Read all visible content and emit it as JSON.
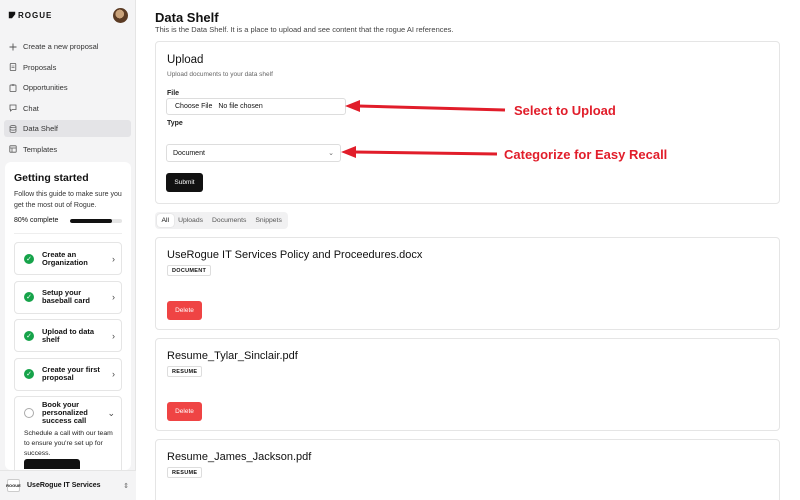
{
  "app": {
    "logo_text": "ROGUE"
  },
  "sidebar": {
    "items": [
      {
        "icon": "plus-icon",
        "label": "Create a new proposal"
      },
      {
        "icon": "document-icon",
        "label": "Proposals"
      },
      {
        "icon": "clipboard-icon",
        "label": "Opportunities"
      },
      {
        "icon": "chat-icon",
        "label": "Chat"
      },
      {
        "icon": "database-icon",
        "label": "Data Shelf",
        "active": true
      },
      {
        "icon": "template-icon",
        "label": "Templates"
      }
    ]
  },
  "guide": {
    "title": "Getting started",
    "description": "Follow this guide to make sure you get the most out of Rogue.",
    "progress_label": "80% complete",
    "progress": 0.8,
    "steps": [
      {
        "label": "Create an Organization",
        "done": true
      },
      {
        "label": "Setup your baseball card",
        "done": true
      },
      {
        "label": "Upload to data shelf",
        "done": true
      },
      {
        "label": "Create your first proposal",
        "done": true
      },
      {
        "label": "Book your personalized success call",
        "done": false,
        "detail": "Schedule a call with our team to ensure you're set up for success."
      }
    ]
  },
  "org": {
    "name": "UseRogue IT Services",
    "logo_text": "ROGUE"
  },
  "page": {
    "title": "Data Shelf",
    "subtitle": "This is the Data Shelf. It is a place to upload and see content that the rogue AI references."
  },
  "upload": {
    "title": "Upload",
    "hint": "Upload documents to your data shelf",
    "file_label": "File",
    "choose_file": "Choose File",
    "no_file": "No file chosen",
    "type_label": "Type",
    "type_value": "Document",
    "submit_label": "Submit"
  },
  "tabs": [
    "All",
    "Uploads",
    "Documents",
    "Snippets"
  ],
  "documents": [
    {
      "name": "UseRogue IT Services Policy and Proceedures.docx",
      "badge": "DOCUMENT",
      "delete_label": "Delete"
    },
    {
      "name": "Resume_Tylar_Sinclair.pdf",
      "badge": "RESUME",
      "delete_label": "Delete"
    },
    {
      "name": "Resume_James_Jackson.pdf",
      "badge": "RESUME"
    }
  ],
  "annotations": {
    "upload": "Select to Upload",
    "categorize": "Categorize for Easy Recall",
    "color": "#e11d2a"
  }
}
